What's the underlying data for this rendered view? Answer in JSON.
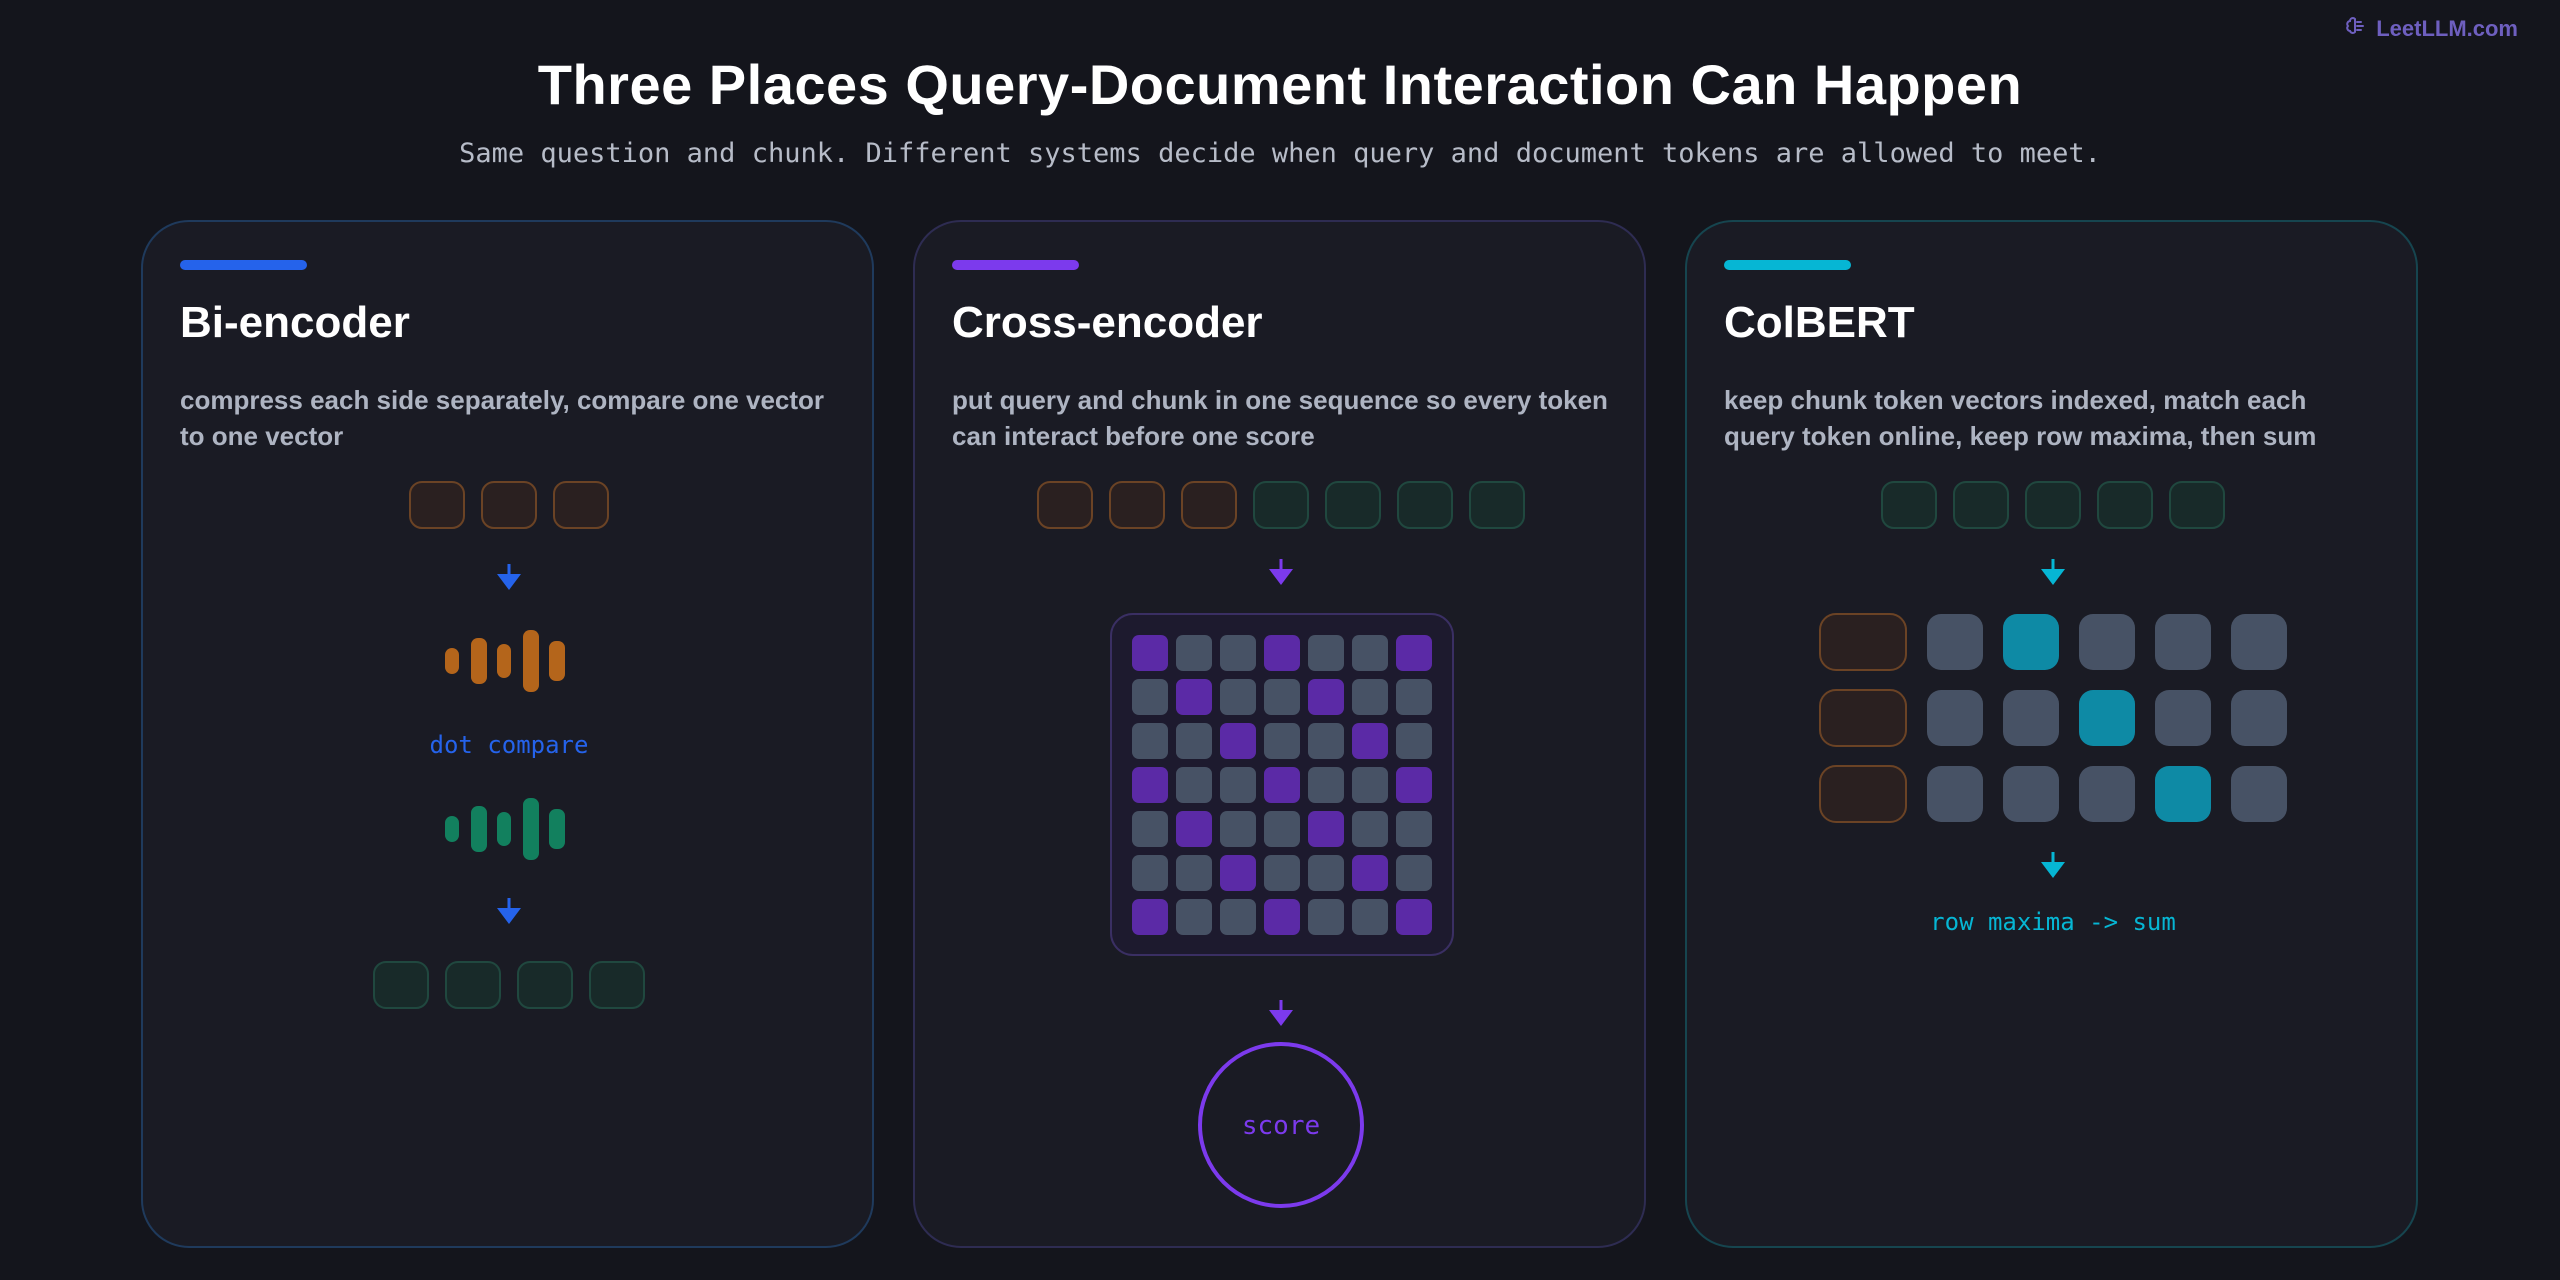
{
  "brand": {
    "label": "LeetLLM.com",
    "icon": "brain-icon",
    "color": "#6e5fbf"
  },
  "header": {
    "title": "Three Places Query-Document Interaction Can Happen",
    "subtitle": "Same question and chunk. Different systems decide when query and document tokens are allowed to meet."
  },
  "colors": {
    "background": "#14151c",
    "card": "#1a1b24",
    "query_token": "#2a2020",
    "query_token_border": "#6b4325",
    "doc_token": "#182a29",
    "doc_token_border": "#20483f",
    "neutral_cell": "#475265"
  },
  "cards": [
    {
      "title": "Bi-encoder",
      "description": "compress each side separately, compare one vector to one vector",
      "accent": "#2563eb",
      "border": "#1f3a5c",
      "compare_label": "dot compare",
      "query_tokens": 3,
      "doc_tokens": 4,
      "query_vector_color": "#b4651b",
      "doc_vector_color": "#12805e"
    },
    {
      "title": "Cross-encoder",
      "description": "put query and chunk in one sequence so every token can interact before one score",
      "accent": "#7c3aed",
      "border": "#2e2c52",
      "query_tokens": 3,
      "doc_tokens": 4,
      "score_label": "score",
      "matrix_active_color": "#5b2aa6",
      "matrix_size": 7
    },
    {
      "title": "ColBERT",
      "description": "keep chunk token vectors indexed, match each query token online, keep row maxima, then sum",
      "accent": "#06b6d4",
      "border": "#16454f",
      "doc_tokens": 5,
      "query_rows": 3,
      "doc_cols": 5,
      "row_max_columns": [
        1,
        2,
        3
      ],
      "max_cell_color": "#0e8aa5",
      "result_label": "row maxima -> sum"
    }
  ]
}
